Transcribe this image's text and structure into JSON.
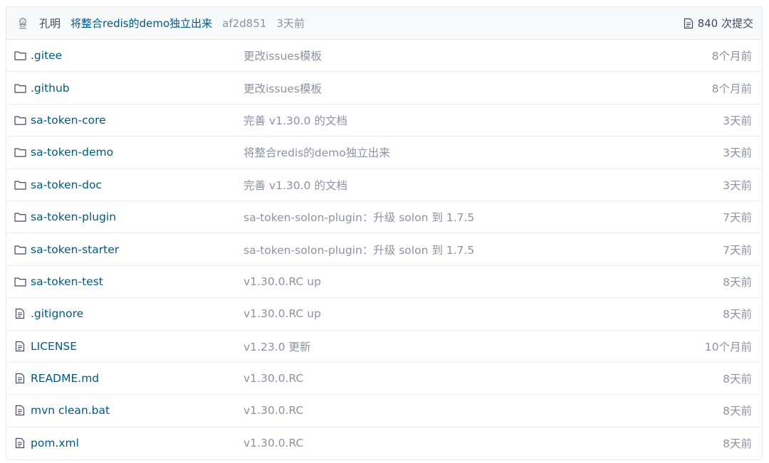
{
  "commit": {
    "author": "孔明",
    "message": "将整合redis的demo独立出来",
    "sha": "af2d851",
    "time": "3天前",
    "commit_count": "840 次提交",
    "avatar_icon": "user-avatar-icon",
    "commits_icon": "document-icon"
  },
  "colors": {
    "link": "#005980",
    "muted": "#8c92a4",
    "border": "#e3e9ed"
  },
  "files": [
    {
      "type": "folder",
      "name": ".gitee",
      "message": "更改issues模板",
      "time": "8个月前"
    },
    {
      "type": "folder",
      "name": ".github",
      "message": "更改issues模板",
      "time": "8个月前"
    },
    {
      "type": "folder",
      "name": "sa-token-core",
      "message": "完善 v1.30.0 的文档",
      "time": "3天前"
    },
    {
      "type": "folder",
      "name": "sa-token-demo",
      "message": "将整合redis的demo独立出来",
      "time": "3天前"
    },
    {
      "type": "folder",
      "name": "sa-token-doc",
      "message": "完善 v1.30.0 的文档",
      "time": "3天前"
    },
    {
      "type": "folder",
      "name": "sa-token-plugin",
      "message": "sa-token-solon-plugin：升级 solon 到 1.7.5",
      "time": "7天前"
    },
    {
      "type": "folder",
      "name": "sa-token-starter",
      "message": "sa-token-solon-plugin：升级 solon 到 1.7.5",
      "time": "7天前"
    },
    {
      "type": "folder",
      "name": "sa-token-test",
      "message": "v1.30.0.RC up",
      "time": "8天前"
    },
    {
      "type": "file",
      "name": ".gitignore",
      "message": "v1.30.0.RC up",
      "time": "8天前"
    },
    {
      "type": "file",
      "name": "LICENSE",
      "message": "v1.23.0 更新",
      "time": "10个月前"
    },
    {
      "type": "file",
      "name": "README.md",
      "message": "v1.30.0.RC",
      "time": "8天前"
    },
    {
      "type": "file",
      "name": "mvn clean.bat",
      "message": "v1.30.0.RC",
      "time": "8天前"
    },
    {
      "type": "file",
      "name": "pom.xml",
      "message": "v1.30.0.RC",
      "time": "8天前"
    }
  ]
}
